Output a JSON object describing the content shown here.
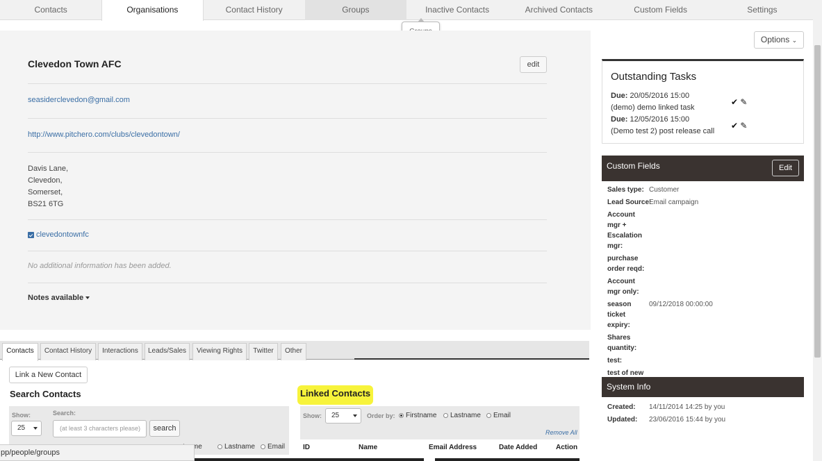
{
  "topnav": {
    "tabs": [
      {
        "label": "Contacts"
      },
      {
        "label": "Organisations"
      },
      {
        "label": "Contact History"
      },
      {
        "label": "Groups"
      },
      {
        "label": "Inactive Contacts"
      },
      {
        "label": "Archived Contacts"
      },
      {
        "label": "Custom Fields"
      },
      {
        "label": "Settings"
      }
    ],
    "tooltip": "Groups"
  },
  "org": {
    "name": "Clevedon Town AFC",
    "edit_label": "edit",
    "email": "seasiderclevedon@gmail.com",
    "website": "http://www.pitchero.com/clubs/clevedontown/",
    "address": [
      "Davis Lane,",
      "Clevedon,",
      "Somerset,",
      "BS21 6TG"
    ],
    "twitter": "clevedontownfc",
    "no_info": "No additional information has been added.",
    "notes_label": "Notes available"
  },
  "options_label": "Options",
  "tasks": {
    "title": "Outstanding Tasks",
    "due_label": "Due:",
    "items": [
      {
        "due": "20/05/2016 15:00",
        "desc": "(demo) demo linked task"
      },
      {
        "due": "12/05/2016 15:00",
        "desc": "(Demo test 2) post release call"
      }
    ]
  },
  "custom_fields": {
    "title": "Custom Fields",
    "edit_label": "Edit",
    "rows": [
      {
        "key": "Sales type:",
        "value": "Customer"
      },
      {
        "key": "Lead Source:",
        "value": "Email campaign"
      },
      {
        "key": "Account mgr + Escalation mgr:",
        "value": ""
      },
      {
        "key": "purchase order reqd:",
        "value": ""
      },
      {
        "key": "Account mgr only:",
        "value": ""
      },
      {
        "key": "season ticket expiry:",
        "value": "09/12/2018 00:00:00"
      },
      {
        "key": "Shares quantity:",
        "value": ""
      },
      {
        "key": "test:",
        "value": ""
      },
      {
        "key": "test of new release:",
        "value": ""
      }
    ]
  },
  "system_info": {
    "title": "System Info",
    "created_label": "Created:",
    "created_value": "14/11/2014 14:25 by you",
    "updated_label": "Updated:",
    "updated_value": "23/06/2016 15:44 by you"
  },
  "bottom_tabs": [
    {
      "label": "Contacts"
    },
    {
      "label": "Contact History"
    },
    {
      "label": "Interactions"
    },
    {
      "label": "Leads/Sales"
    },
    {
      "label": "Viewing Rights"
    },
    {
      "label": "Twitter"
    },
    {
      "label": "Other"
    }
  ],
  "link_contact_label": "Link a New Contact",
  "search_contacts": {
    "title": "Search Contacts",
    "show_label": "Show:",
    "show_value": "25",
    "search_label": "Search:",
    "search_placeholder": "(at least 3 characters please)",
    "search_button": "search",
    "order_partial": "tname",
    "order_lastname": "Lastname",
    "order_email": "Email"
  },
  "linked_contacts": {
    "title": "Linked Contacts",
    "show_label": "Show:",
    "show_value": "25",
    "order_label": "Order by:",
    "order_firstname": "Firstname",
    "order_lastname": "Lastname",
    "order_email": "Email",
    "remove_all": "Remove All",
    "columns": [
      "ID",
      "Name",
      "Email Address",
      "Date Added",
      "Action"
    ]
  },
  "status_url": "pp/people/groups"
}
